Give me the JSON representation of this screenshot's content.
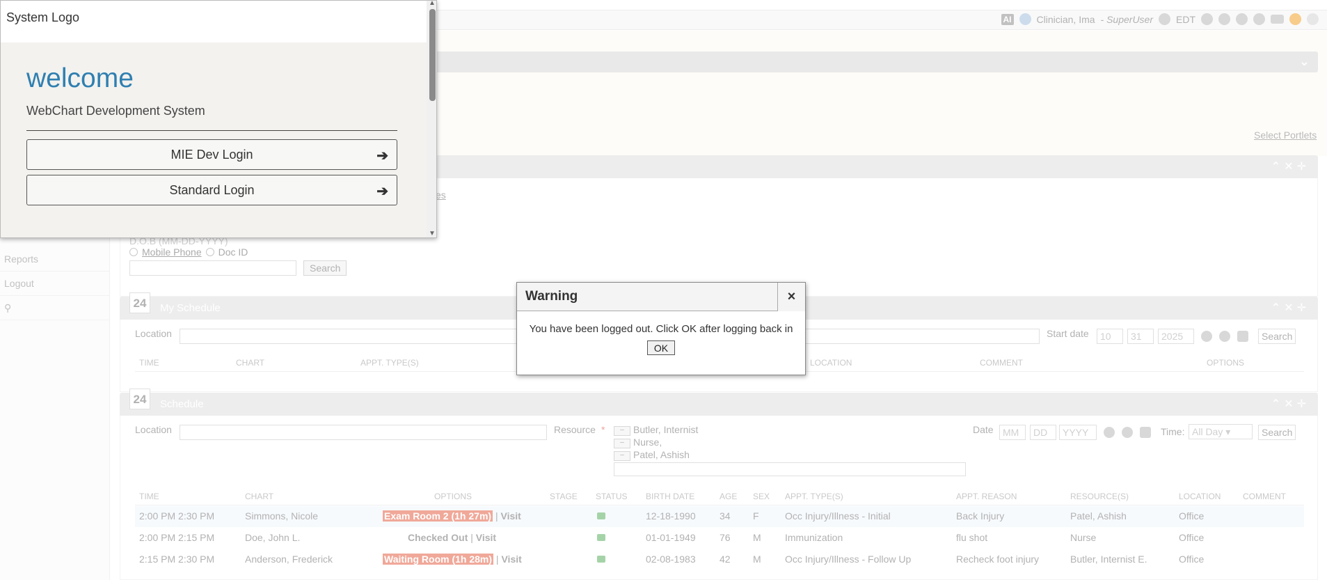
{
  "topbar": {
    "ai_label": "AI",
    "user": "Clinician, Ima",
    "role": "- SuperUser",
    "timezone": "EDT"
  },
  "select_portlets": "Select Portlets",
  "sidebar": {
    "items": [
      {
        "label": "Reports"
      },
      {
        "label": "Logout"
      }
    ]
  },
  "patient_search": {
    "radio_dob": "D.O.B (MM-DD-YYYY)",
    "radio_mobile": "Mobile Phone",
    "radio_docid": "Doc ID",
    "search_button": "Search",
    "fragment": "es"
  },
  "my_schedule": {
    "icon_day": "24",
    "title": "My Schedule",
    "location_label": "Location",
    "start_date_label": "Start date",
    "start_month": "10",
    "start_day": "31",
    "start_year": "2025",
    "search_button": "Search",
    "columns": [
      "Time",
      "Chart",
      "Appt. Type(s)",
      "Location",
      "Comment",
      "Options"
    ]
  },
  "schedule": {
    "icon_day": "24",
    "title": "Schedule",
    "location_label": "Location",
    "resource_label": "Resource",
    "resources": [
      "Butler, Internist",
      "Nurse,",
      "Patel, Ashish"
    ],
    "date_label": "Date",
    "date_mm": "MM",
    "date_dd": "DD",
    "date_yyyy": "YYYY",
    "time_label": "Time:",
    "time_value": "All Day",
    "search_button": "Search",
    "columns": [
      "Time",
      "Chart",
      "Options",
      "Stage",
      "Status",
      "Birth Date",
      "Age",
      "Sex",
      "Appt. Type(s)",
      "Appt. Reason",
      "Resource(s)",
      "Location",
      "Comment"
    ],
    "rows": [
      {
        "time": "2:00 PM 2:30 PM",
        "chart": "Simmons, Nicole",
        "option_pill": "Exam Room 2 (1h 27m)",
        "option_sep": " | ",
        "option_link": "Visit",
        "birth": "12-18-1990",
        "age": "34",
        "sex": "F",
        "type": "Occ Injury/Illness - Initial",
        "reason": "Back Injury",
        "resource": "Patel, Ashish",
        "location": "Office"
      },
      {
        "time": "2:00 PM 2:15 PM",
        "chart": "Doe, John L.",
        "option_pill": "",
        "option_text": "Checked Out",
        "option_sep": " | ",
        "option_link": "Visit",
        "birth": "01-01-1949",
        "age": "76",
        "sex": "M",
        "type": "Immunization",
        "reason": "flu shot",
        "resource": "Nurse",
        "location": "Office"
      },
      {
        "time": "2:15 PM 2:30 PM",
        "chart": "Anderson, Frederick",
        "option_pill": "Waiting Room (1h 28m)",
        "option_sep": " | ",
        "option_link": "Visit",
        "birth": "02-08-1983",
        "age": "42",
        "sex": "M",
        "type": "Occ Injury/Illness - Follow Up",
        "reason": "Recheck foot injury",
        "resource": "Butler, Internist E.",
        "location": "Office"
      }
    ]
  },
  "login_popup": {
    "logo_alt": "System Logo",
    "welcome": "welcome",
    "subtitle": "WebChart Development System",
    "buttons": [
      {
        "label": "MIE Dev Login"
      },
      {
        "label": "Standard Login"
      }
    ]
  },
  "warning": {
    "title": "Warning",
    "close": "×",
    "message": "You have been logged out. Click OK after logging back in",
    "ok": "OK"
  }
}
